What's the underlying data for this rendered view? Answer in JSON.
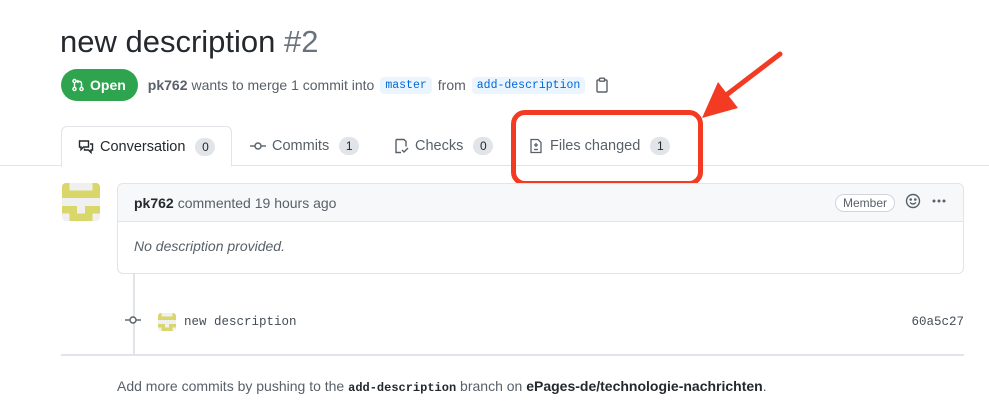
{
  "pr": {
    "title": "new description",
    "number": "#2"
  },
  "meta": {
    "state": "Open",
    "author": "pk762",
    "merge_text": "wants to merge 1 commit into",
    "base_branch": "master",
    "from_text": "from",
    "head_branch": "add-description"
  },
  "tabs": [
    {
      "label": "Conversation",
      "count": "0",
      "icon": "comment-discussion-icon"
    },
    {
      "label": "Commits",
      "count": "1",
      "icon": "git-commit-icon"
    },
    {
      "label": "Checks",
      "count": "0",
      "icon": "checklist-icon"
    },
    {
      "label": "Files changed",
      "count": "1",
      "icon": "file-diff-icon"
    }
  ],
  "comment": {
    "author": "pk762",
    "meta": "commented 19 hours ago",
    "role": "Member",
    "body": "No description provided."
  },
  "commit": {
    "message": "new description",
    "sha": "60a5c27"
  },
  "footer": {
    "prefix": "Add more commits by pushing to the",
    "branch": "add-description",
    "middle": "branch on",
    "repo": "ePages-de/technologie-nachrichten",
    "suffix": "."
  },
  "colors": {
    "open_green": "#2ea44f",
    "annotation_red": "#f23b22",
    "link_blue": "#0366d6"
  }
}
